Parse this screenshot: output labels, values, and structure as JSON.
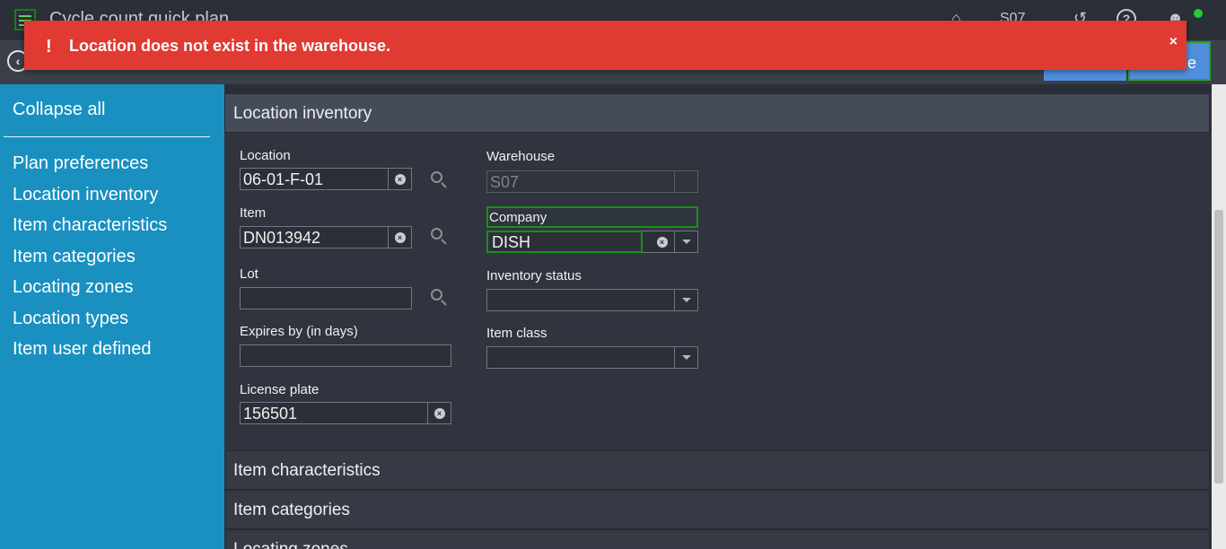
{
  "app": {
    "title": "Cycle count quick plan",
    "warehouse": "S07"
  },
  "toast": {
    "message": "Location does not exist in the warehouse.",
    "icon": "!",
    "close": "×"
  },
  "toolbar": {
    "save_label": "e"
  },
  "sidebar": {
    "collapse_all": "Collapse all",
    "items": [
      {
        "label": "Plan preferences"
      },
      {
        "label": "Location inventory"
      },
      {
        "label": "Item characteristics"
      },
      {
        "label": "Item categories"
      },
      {
        "label": "Locating zones"
      },
      {
        "label": "Location types"
      },
      {
        "label": "Item user defined"
      }
    ]
  },
  "sections": {
    "location_inventory": "Location inventory",
    "item_characteristics": "Item characteristics",
    "item_categories": "Item categories",
    "locating_zones": "Locating zones"
  },
  "form": {
    "location": {
      "label": "Location",
      "value": "06-01-F-01"
    },
    "item": {
      "label": "Item",
      "value": "DN013942"
    },
    "lot": {
      "label": "Lot",
      "value": ""
    },
    "expires_by": {
      "label": "Expires by (in days)",
      "value": ""
    },
    "license_plate": {
      "label": "License plate",
      "value": "156501"
    },
    "warehouse": {
      "label": "Warehouse",
      "value": "S07"
    },
    "company": {
      "label": "Company",
      "value": "DISH"
    },
    "inventory_status": {
      "label": "Inventory status",
      "value": ""
    },
    "item_class": {
      "label": "Item class",
      "value": ""
    }
  },
  "colors": {
    "error": "#e03a32",
    "sidebar": "#1990c0",
    "focus": "#1b8f1b",
    "online": "#22cc33"
  }
}
